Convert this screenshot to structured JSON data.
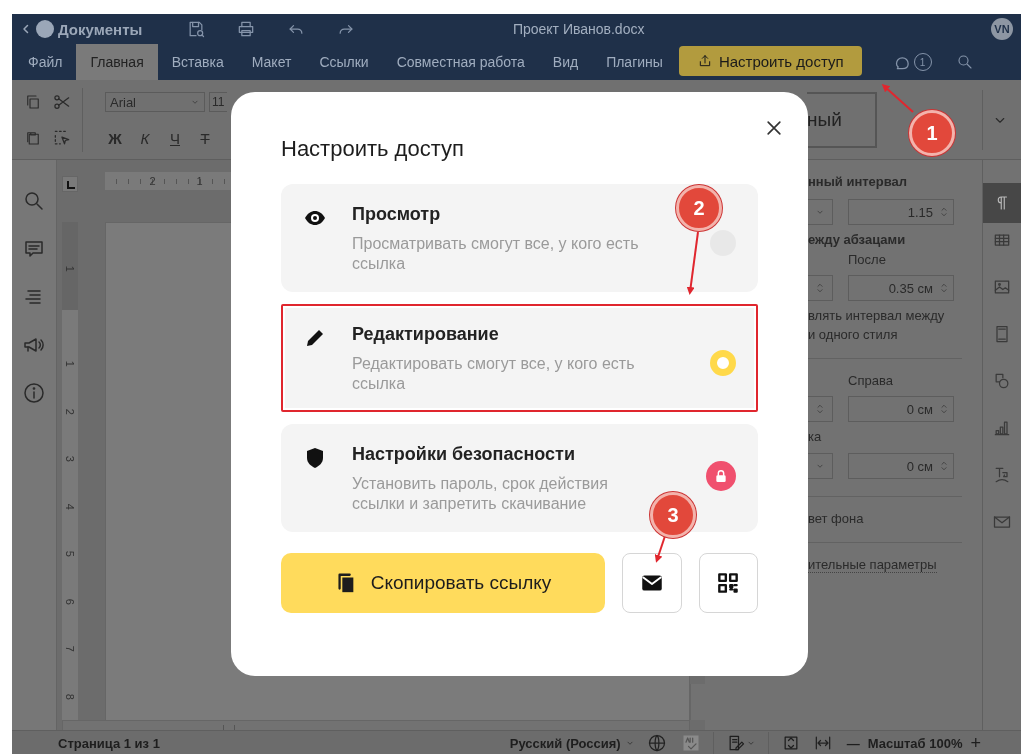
{
  "header": {
    "back_label": "Документы",
    "title": "Проект Иванов.docx",
    "avatar": "VN"
  },
  "tabs": [
    {
      "label": "Файл",
      "selected": false
    },
    {
      "label": "Главная",
      "selected": true
    },
    {
      "label": "Вставка",
      "selected": false
    },
    {
      "label": "Макет",
      "selected": false
    },
    {
      "label": "Ссылки",
      "selected": false
    },
    {
      "label": "Совместная работа",
      "selected": false
    },
    {
      "label": "Вид",
      "selected": false
    },
    {
      "label": "Плагины",
      "selected": false
    }
  ],
  "share_button": {
    "label": "Настроить доступ"
  },
  "comments_badge": "1",
  "toolbar": {
    "font": "Arial",
    "font_size": "11",
    "format_buttons": [
      "Ж",
      "К",
      "Ч",
      "Т"
    ],
    "style_preview": "ный"
  },
  "ruler": {
    "top_marks": [
      "2",
      "1"
    ],
    "side_marks": [
      "1",
      "1",
      "2",
      "3",
      "4",
      "5",
      "6",
      "7",
      "8"
    ]
  },
  "right_panel": {
    "items": [
      {
        "kind": "heading",
        "text": "нный интервал"
      },
      {
        "kind": "dropdown_fields",
        "value": "1.15"
      },
      {
        "kind": "heading",
        "text": "ежду абзацами"
      },
      {
        "kind": "label",
        "text": "После"
      },
      {
        "kind": "spinner_fields",
        "value": "0.35 см"
      },
      {
        "kind": "text",
        "text": "влять интервал между"
      },
      {
        "kind": "text",
        "text": "и одного стиля"
      },
      {
        "kind": "divider"
      },
      {
        "kind": "label",
        "text": "Справа"
      },
      {
        "kind": "spinner_fields",
        "value": "0 см"
      },
      {
        "kind": "text",
        "text": "ка"
      },
      {
        "kind": "dropdown_fields",
        "value": "0 см"
      },
      {
        "kind": "divider"
      },
      {
        "kind": "text",
        "text": "вет фона"
      },
      {
        "kind": "divider"
      },
      {
        "kind": "link",
        "text": "ительные параметры"
      }
    ]
  },
  "dialog": {
    "title": "Настроить доступ",
    "options": [
      {
        "kind": "radio",
        "title": "Просмотр",
        "description": "Просматривать смогут все, у кого есть ссылка",
        "selected": false,
        "highlighted": false
      },
      {
        "kind": "radio",
        "title": "Редактирование",
        "description": "Редактировать смогут все, у кого есть ссылка",
        "selected": true,
        "highlighted": true
      },
      {
        "kind": "lock",
        "title": "Настройки безопасности",
        "description": "Установить пароль, срок действия ссылки и запретить скачивание",
        "selected": false,
        "highlighted": false
      }
    ],
    "copy_button": "Скопировать ссылку"
  },
  "annotations": [
    {
      "number": "1"
    },
    {
      "number": "2"
    },
    {
      "number": "3"
    }
  ],
  "status_bar": {
    "page": "Страница 1 из 1",
    "language": "Русский (Россия)",
    "zoom_out": "—",
    "zoom": "Масштаб 100%",
    "zoom_in": "+"
  }
}
